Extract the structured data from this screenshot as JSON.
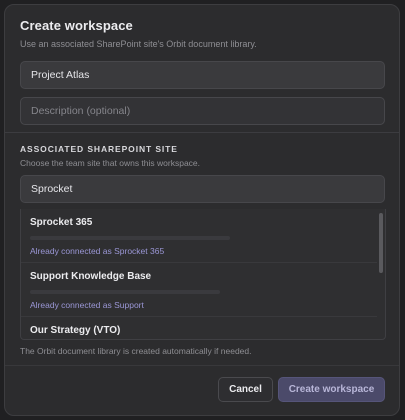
{
  "dialog": {
    "title": "Create workspace",
    "subtitle": "Use an associated SharePoint site's Orbit document library."
  },
  "form": {
    "name_value": "Project Atlas",
    "description_placeholder": "Description (optional)"
  },
  "site_section": {
    "heading": "ASSOCIATED SHAREPOINT SITE",
    "help": "Choose the team site that owns this workspace.",
    "search_value": "Sprocket"
  },
  "site_options": [
    {
      "title": "Sprocket 365",
      "status": "Already connected as Sprocket 365"
    },
    {
      "title": "Support Knowledge Base",
      "status": "Already connected as Support"
    },
    {
      "title": "Our Strategy (VTO)",
      "status": ""
    }
  ],
  "footnote": "The Orbit document library is created automatically if needed.",
  "buttons": {
    "cancel": "Cancel",
    "create": "Create workspace"
  },
  "colors": {
    "accent": "#4b4a6a",
    "status_text": "#9b97d6"
  }
}
